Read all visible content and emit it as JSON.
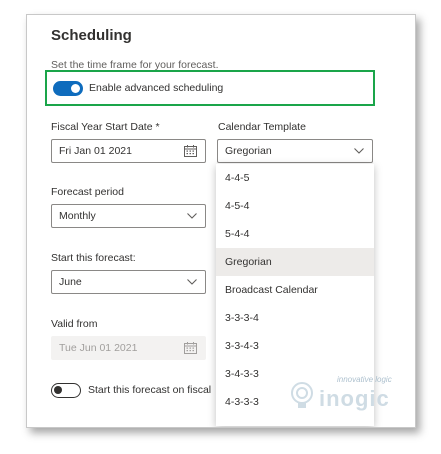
{
  "section": {
    "title": "Scheduling",
    "subtitle": "Set the time frame for your forecast."
  },
  "advanced_scheduling": {
    "label": "Enable advanced scheduling",
    "enabled": true
  },
  "fiscal_year_start": {
    "label": "Fiscal Year Start Date *",
    "value": "Fri Jan 01 2021"
  },
  "calendar_template": {
    "label": "Calendar Template",
    "value": "Gregorian",
    "options": [
      "4-4-5",
      "4-5-4",
      "5-4-4",
      "Gregorian",
      "Broadcast Calendar",
      "3-3-3-4",
      "3-3-4-3",
      "3-4-3-3",
      "4-3-3-3"
    ],
    "selected_option": "Gregorian"
  },
  "forecast_period": {
    "label": "Forecast period",
    "value": "Monthly"
  },
  "start_forecast": {
    "label": "Start this forecast:",
    "value": "June"
  },
  "valid_from": {
    "label": "Valid from",
    "value": "Tue Jun 01 2021"
  },
  "fiscal_toggle": {
    "label": "Start this forecast on fiscal",
    "enabled": false
  },
  "watermark": {
    "tagline": "innovative logic"
  },
  "colors": {
    "accent": "#0f6cbd",
    "highlight_border": "#1aa54a",
    "selected_option_bg": "#edebe9"
  }
}
